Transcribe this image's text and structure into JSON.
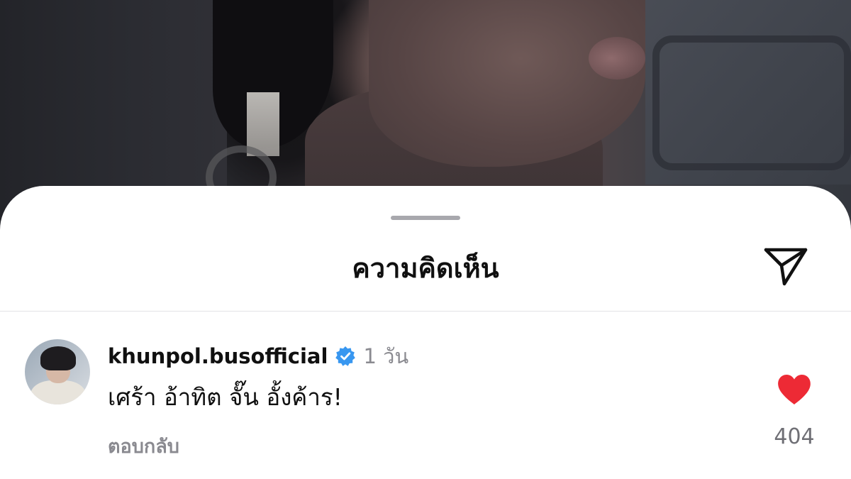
{
  "sheet": {
    "title": "ความคิดเห็น",
    "share_icon": "paper-plane-icon"
  },
  "comment": {
    "username": "khunpol.busofficial",
    "verified": true,
    "verified_icon": "verified-badge-icon",
    "verified_color": "#3897f0",
    "time": "1 วัน",
    "text": "เศร้า อ้าทิต จั๊น อั้งค้าร!",
    "reply_label": "ตอบกลับ",
    "like_icon": "heart-icon",
    "like_color": "#ed2a35",
    "liked": true,
    "like_count": "404"
  }
}
